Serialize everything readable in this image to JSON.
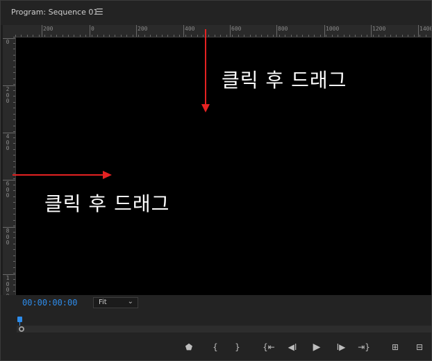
{
  "panel": {
    "title": "Program: Sequence 01",
    "menu_icon": "hamburger-menu-icon"
  },
  "ruler": {
    "horizontal_labels": [
      "200",
      "0",
      "200",
      "400",
      "600",
      "800",
      "1000",
      "1200",
      "1400"
    ],
    "vertical_labels": [
      "0",
      "200",
      "400",
      "600",
      "800",
      "1000"
    ]
  },
  "annotations": {
    "top_label": "클릭 후 드래그",
    "left_label": "클릭 후 드래그",
    "arrow_color": "#e52222"
  },
  "controls": {
    "timecode": "00:00:00:00",
    "zoom_select": {
      "selected": "Fit"
    },
    "buttons": [
      {
        "name": "add-marker-button",
        "icon": "marker-icon",
        "glyph": "⬟"
      },
      {
        "name": "mark-in-button",
        "icon": "mark-in-icon",
        "glyph": "{"
      },
      {
        "name": "mark-out-button",
        "icon": "mark-out-icon",
        "glyph": "}"
      },
      {
        "name": "go-to-in-button",
        "icon": "go-to-in-icon",
        "glyph": "{⇤"
      },
      {
        "name": "step-back-button",
        "icon": "step-back-icon",
        "glyph": "◀I"
      },
      {
        "name": "play-button",
        "icon": "play-icon",
        "glyph": "▶"
      },
      {
        "name": "step-forward-button",
        "icon": "step-forward-icon",
        "glyph": "I▶"
      },
      {
        "name": "go-to-out-button",
        "icon": "go-to-out-icon",
        "glyph": "⇥}"
      },
      {
        "name": "lift-button",
        "icon": "lift-icon",
        "glyph": "⊞"
      },
      {
        "name": "extract-button",
        "icon": "extract-icon",
        "glyph": "⊟"
      }
    ]
  },
  "colors": {
    "accent_blue": "#2d8ceb",
    "panel_bg": "#232323",
    "video_bg": "#000000"
  }
}
